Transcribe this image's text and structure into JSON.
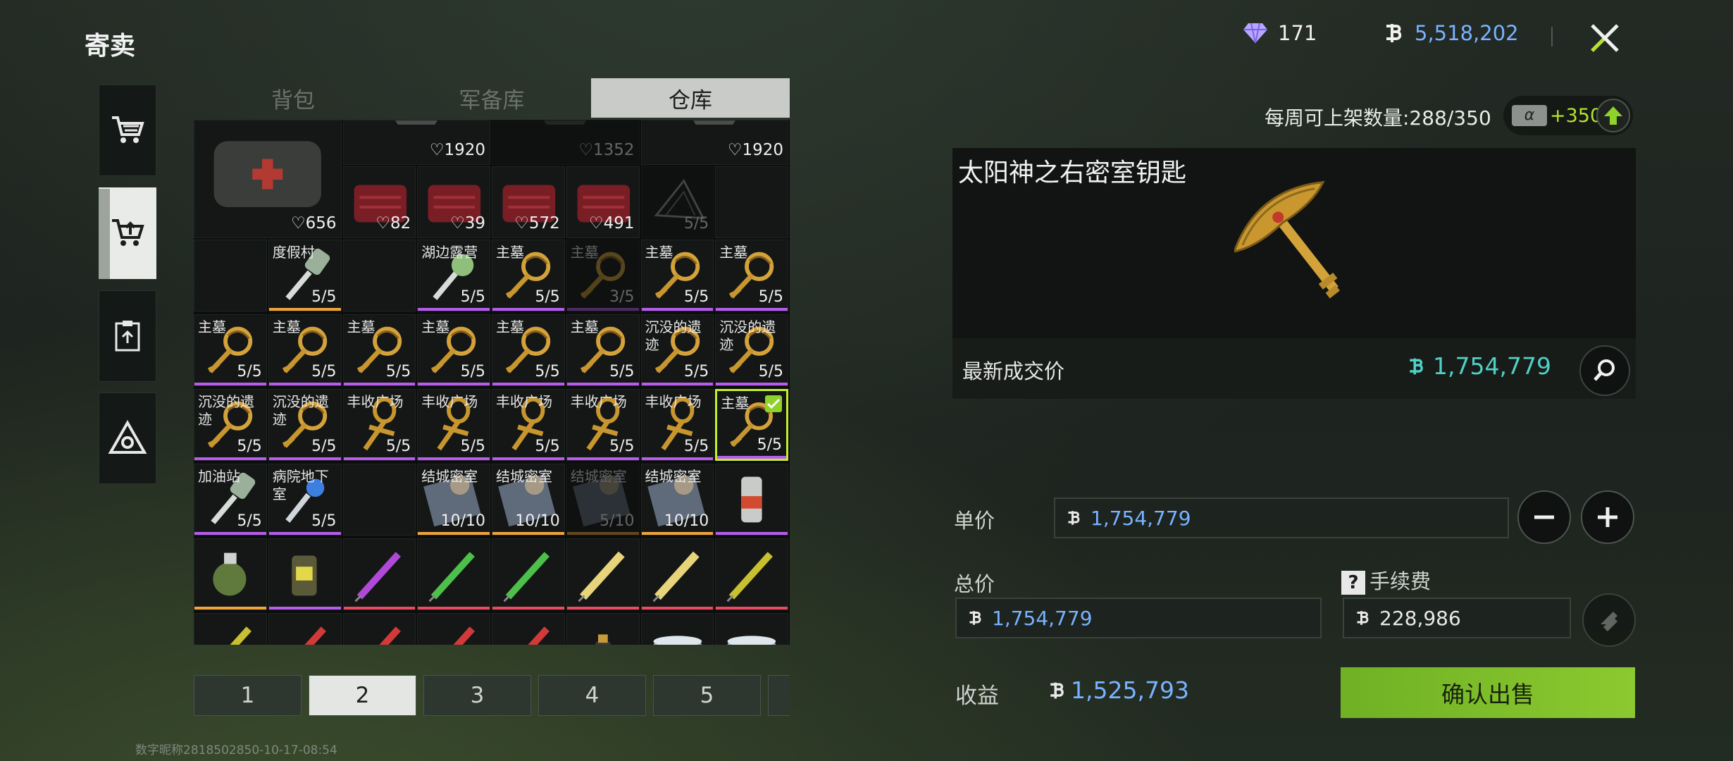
{
  "title": "寄卖",
  "watermark": "数字昵称2818502850-10-17-08:54",
  "tabs": [
    "背包",
    "军备库",
    "仓库"
  ],
  "active_tab": 2,
  "currency": {
    "diamonds": "171",
    "coins": "5,518,202"
  },
  "weekly_limit": "每周可上架数量:288/350",
  "boost": {
    "badge": "α",
    "plus": "+350"
  },
  "detail": {
    "name": "太阳神之右密室钥匙",
    "last_price_label": "最新成交价",
    "last_price": "1,754,779"
  },
  "form": {
    "unit_price_label": "单价",
    "unit_price": "1,754,779",
    "total_label": "总价",
    "total": "1,754,779",
    "fee_label": "手续费",
    "fee": "228,986",
    "profit_label": "收益",
    "profit": "1,525,793",
    "confirm": "确认出售"
  },
  "pages": [
    "1",
    "2",
    "3",
    "4",
    "5",
    ""
  ],
  "active_page": 1,
  "inventory": {
    "top_row": [
      {
        "dur": "656",
        "type": "bag"
      },
      {
        "dur": "1920",
        "type": "armor"
      },
      {
        "dur": "1352",
        "type": "armor",
        "dim": true
      },
      {
        "dur": "1920",
        "type": "armor"
      }
    ],
    "row2": [
      {
        "dur": "82",
        "type": "box"
      },
      {
        "dur": "39",
        "type": "box"
      },
      {
        "dur": "572",
        "type": "box"
      },
      {
        "dur": "491",
        "type": "box"
      },
      {
        "qty": "5/5",
        "type": "net",
        "dim": true
      },
      {
        "type": "empty"
      }
    ],
    "row3": [
      {
        "type": "empty"
      },
      {
        "name": "度假村",
        "qty": "5/5",
        "type": "key-silver",
        "rarity": "orange"
      },
      {
        "type": "empty"
      },
      {
        "name": "湖边露营",
        "qty": "5/5",
        "type": "key-green",
        "rarity": "purple"
      },
      {
        "name": "主墓",
        "qty": "5/5",
        "type": "key-gold",
        "rarity": "purple"
      },
      {
        "name": "主墓",
        "qty": "3/5",
        "type": "key-gold",
        "rarity": "purple",
        "dim": true
      },
      {
        "name": "主墓",
        "qty": "5/5",
        "type": "key-gold",
        "rarity": "purple"
      },
      {
        "name": "主墓",
        "qty": "5/5",
        "type": "key-gold",
        "rarity": "purple"
      }
    ],
    "row4": [
      {
        "name": "主墓",
        "qty": "5/5",
        "type": "key-gold",
        "rarity": "purple"
      },
      {
        "name": "主墓",
        "qty": "5/5",
        "type": "key-gold",
        "rarity": "purple"
      },
      {
        "name": "主墓",
        "qty": "5/5",
        "type": "key-gold",
        "rarity": "purple"
      },
      {
        "name": "主墓",
        "qty": "5/5",
        "type": "key-gold",
        "rarity": "purple"
      },
      {
        "name": "主墓",
        "qty": "5/5",
        "type": "key-gold",
        "rarity": "purple"
      },
      {
        "name": "主墓",
        "qty": "5/5",
        "type": "key-gold",
        "rarity": "purple"
      },
      {
        "name": "沉没的遗迹",
        "qty": "5/5",
        "type": "key-gold",
        "rarity": "purple"
      },
      {
        "name": "沉没的遗迹",
        "qty": "5/5",
        "type": "key-gold",
        "rarity": "purple"
      }
    ],
    "row5": [
      {
        "name": "沉没的遗迹",
        "qty": "5/5",
        "type": "key-gold",
        "rarity": "purple"
      },
      {
        "name": "沉没的遗迹",
        "qty": "5/5",
        "type": "key-gold",
        "rarity": "purple"
      },
      {
        "name": "丰收广场",
        "qty": "5/5",
        "type": "ankh",
        "rarity": "purple"
      },
      {
        "name": "丰收广场",
        "qty": "5/5",
        "type": "ankh",
        "rarity": "purple"
      },
      {
        "name": "丰收广场",
        "qty": "5/5",
        "type": "ankh",
        "rarity": "purple"
      },
      {
        "name": "丰收广场",
        "qty": "5/5",
        "type": "ankh",
        "rarity": "purple"
      },
      {
        "name": "丰收广场",
        "qty": "5/5",
        "type": "ankh",
        "rarity": "purple"
      },
      {
        "name": "主墓",
        "qty": "5/5",
        "type": "key-gold",
        "rarity": "purple",
        "selected": true
      }
    ],
    "row6": [
      {
        "name": "加油站",
        "qty": "5/5",
        "type": "key-silver",
        "rarity": "purple"
      },
      {
        "name": "病院地下室",
        "qty": "5/5",
        "type": "key-blue",
        "rarity": "purple"
      },
      {
        "type": "empty"
      },
      {
        "name": "结城密室",
        "qty": "10/10",
        "type": "card",
        "rarity": "orange"
      },
      {
        "name": "结城密室",
        "qty": "10/10",
        "type": "card",
        "rarity": "orange"
      },
      {
        "name": "结城密室",
        "qty": "5/10",
        "type": "card",
        "rarity": "orange",
        "dim": true
      },
      {
        "name": "结城密室",
        "qty": "10/10",
        "type": "card",
        "rarity": "orange"
      },
      {
        "type": "canister",
        "rarity": "purple"
      }
    ],
    "row7": [
      {
        "type": "grenade",
        "rarity": "orange"
      },
      {
        "type": "grenade-yellow",
        "rarity": "purple"
      },
      {
        "type": "syringe-purple",
        "rarity": "red"
      },
      {
        "type": "syringe-green",
        "rarity": "red"
      },
      {
        "type": "syringe-green",
        "rarity": "red"
      },
      {
        "type": "syringe-gold",
        "rarity": "red"
      },
      {
        "type": "syringe-gold",
        "rarity": "red"
      },
      {
        "type": "syringe-yellow",
        "rarity": "red"
      }
    ],
    "row8": [
      {
        "type": "syringe-yellow"
      },
      {
        "type": "syringe-red"
      },
      {
        "type": "syringe-red"
      },
      {
        "type": "syringe-red"
      },
      {
        "type": "syringe-red"
      },
      {
        "type": "bottle"
      },
      {
        "type": "tin"
      },
      {
        "type": "tin"
      }
    ]
  },
  "colors": {
    "rarity_purple": "#b85cf0",
    "rarity_orange": "#f0a43a",
    "rarity_red": "#ea4a62",
    "rarity_pink": "#e5577f",
    "accent_green": "#8cc930",
    "price_blue": "#79b3ff",
    "price_teal": "#4fd1c5"
  }
}
